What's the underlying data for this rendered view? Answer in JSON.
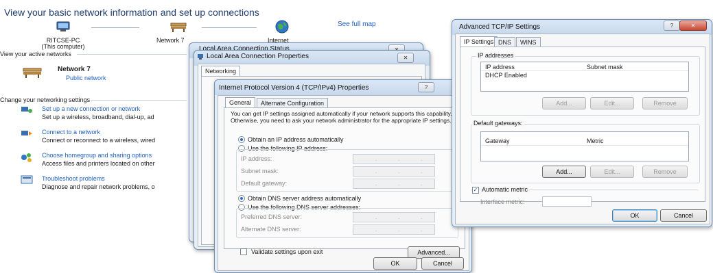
{
  "network_center": {
    "heading": "View your basic network information and set up connections",
    "see_full_map": "See full map",
    "map": {
      "computer_name": "RITCSE-PC",
      "computer_sub": "(This computer)",
      "network_name": "Network 7",
      "internet_label": "Internet"
    },
    "active_networks_label": "View your active networks",
    "active_network_name": "Network 7",
    "active_network_type": "Public network",
    "change_settings_label": "Change your networking settings",
    "tasks": [
      {
        "title": "Set up a new connection or network",
        "desc": "Set up a wireless, broadband, dial-up, ad"
      },
      {
        "title": "Connect to a network",
        "desc": "Connect or reconnect to a wireless, wired"
      },
      {
        "title": "Choose homegroup and sharing options",
        "desc": "Access files and printers located on other"
      },
      {
        "title": "Troubleshoot problems",
        "desc": "Diagnose and repair network problems, o"
      }
    ]
  },
  "status_window": {
    "title": "Local Area Connection Status"
  },
  "properties_window": {
    "title": "Local Area Connection Properties",
    "tab": "Networking"
  },
  "ipv4_dialog": {
    "title": "Internet Protocol Version 4 (TCP/IPv4) Properties",
    "help_glyph": "?",
    "tabs": [
      "General",
      "Alternate Configuration"
    ],
    "intro": "You can get IP settings assigned automatically if your network supports this capability. Otherwise, you need to ask your network administrator for the appropriate IP settings.",
    "obtain_ip_auto": "Obtain an IP address automatically",
    "use_following_ip": "Use the following IP address:",
    "ip_address_label": "IP address:",
    "subnet_mask_label": "Subnet mask:",
    "default_gateway_label": "Default gateway:",
    "obtain_dns_auto": "Obtain DNS server address automatically",
    "use_following_dns": "Use the following DNS server addresses:",
    "preferred_dns_label": "Preferred DNS server:",
    "alternate_dns_label": "Alternate DNS server:",
    "validate_label": "Validate settings upon exit",
    "advanced_button": "Advanced...",
    "ok_button": "OK",
    "cancel_button": "Cancel",
    "ip_dots": ". . ."
  },
  "advanced_dialog": {
    "title": "Advanced TCP/IP Settings",
    "tabs": [
      "IP Settings",
      "DNS",
      "WINS"
    ],
    "ip_addresses_group": "IP addresses",
    "ip_columns": [
      "IP address",
      "Subnet mask"
    ],
    "ip_rows": [
      "DHCP Enabled"
    ],
    "add_button": "Add...",
    "edit_button": "Edit...",
    "remove_button": "Remove",
    "gateways_group": "Default gateways:",
    "gateway_columns": [
      "Gateway",
      "Metric"
    ],
    "automatic_metric": "Automatic metric",
    "interface_metric_label": "Interface metric:",
    "ok_button": "OK",
    "cancel_button": "Cancel"
  }
}
